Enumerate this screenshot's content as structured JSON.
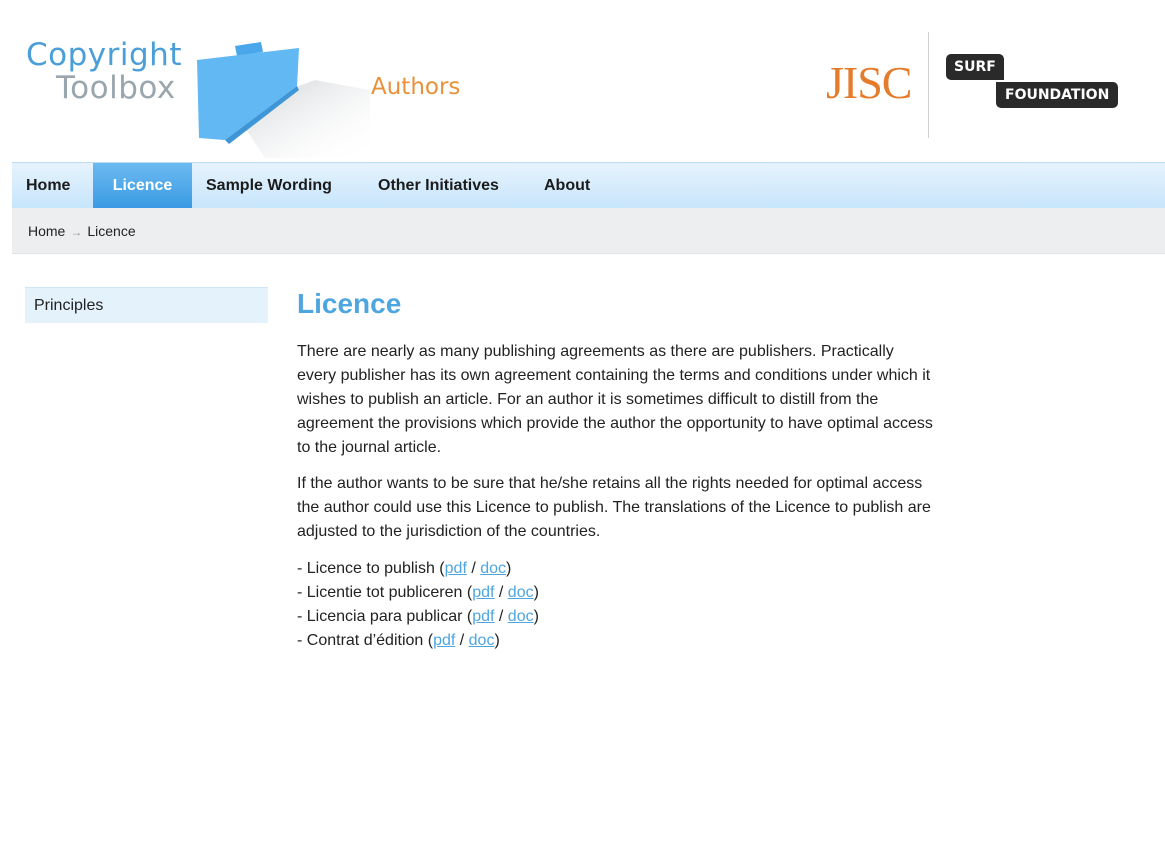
{
  "header": {
    "logo_line1": "Copyright",
    "logo_line2": "Toolbox",
    "section": "Authors",
    "jisc": "JISC",
    "surf_top": "SURF",
    "surf_bottom": "FOUNDATION"
  },
  "nav": {
    "items": [
      {
        "label": "Home"
      },
      {
        "label": "Licence"
      },
      {
        "label": "Sample Wording"
      },
      {
        "label": "Other Initiatives"
      },
      {
        "label": "About"
      }
    ],
    "active": "Licence"
  },
  "breadcrumb": {
    "home": "Home",
    "separator": "→",
    "current": "Licence"
  },
  "sidebar": {
    "items": [
      {
        "label": "Principles"
      }
    ]
  },
  "main": {
    "title": "Licence",
    "paragraph1": "There are nearly as many publishing agreements as there are publishers. Practically every publisher has its own agreement containing the terms and conditions under which it wishes to publish an article. For an author it is sometimes difficult to distill from the agreement the provisions which provide the author the opportunity to have optimal access to the journal article.",
    "paragraph2": "If the author wants to be sure that he/she retains all the rights needed for optimal access the author could use this Licence to publish. The translations of the Licence to publish are adjusted to the jurisdiction of the countries.",
    "downloads": [
      {
        "prefix": "- Licence to publish (",
        "pdf": "pdf",
        "slash": " / ",
        "doc": "doc",
        "suffix": ")"
      },
      {
        "prefix": "- Licentie tot publiceren (",
        "pdf": "pdf",
        "slash": " / ",
        "doc": "doc",
        "suffix": ")"
      },
      {
        "prefix": "- Licencia para publicar (",
        "pdf": "pdf",
        "slash": " / ",
        "doc": "doc",
        "suffix": ")"
      },
      {
        "prefix": "- Contrat d’édition (",
        "pdf": "pdf",
        "slash": " / ",
        "doc": "doc",
        "suffix": ")"
      }
    ]
  },
  "colors": {
    "accent_blue": "#4ea6e0",
    "nav_active": "#3a9be3",
    "section_orange": "#e8913a",
    "jisc_orange": "#e57c2c"
  },
  "icons": [
    "toolbox-icon"
  ]
}
